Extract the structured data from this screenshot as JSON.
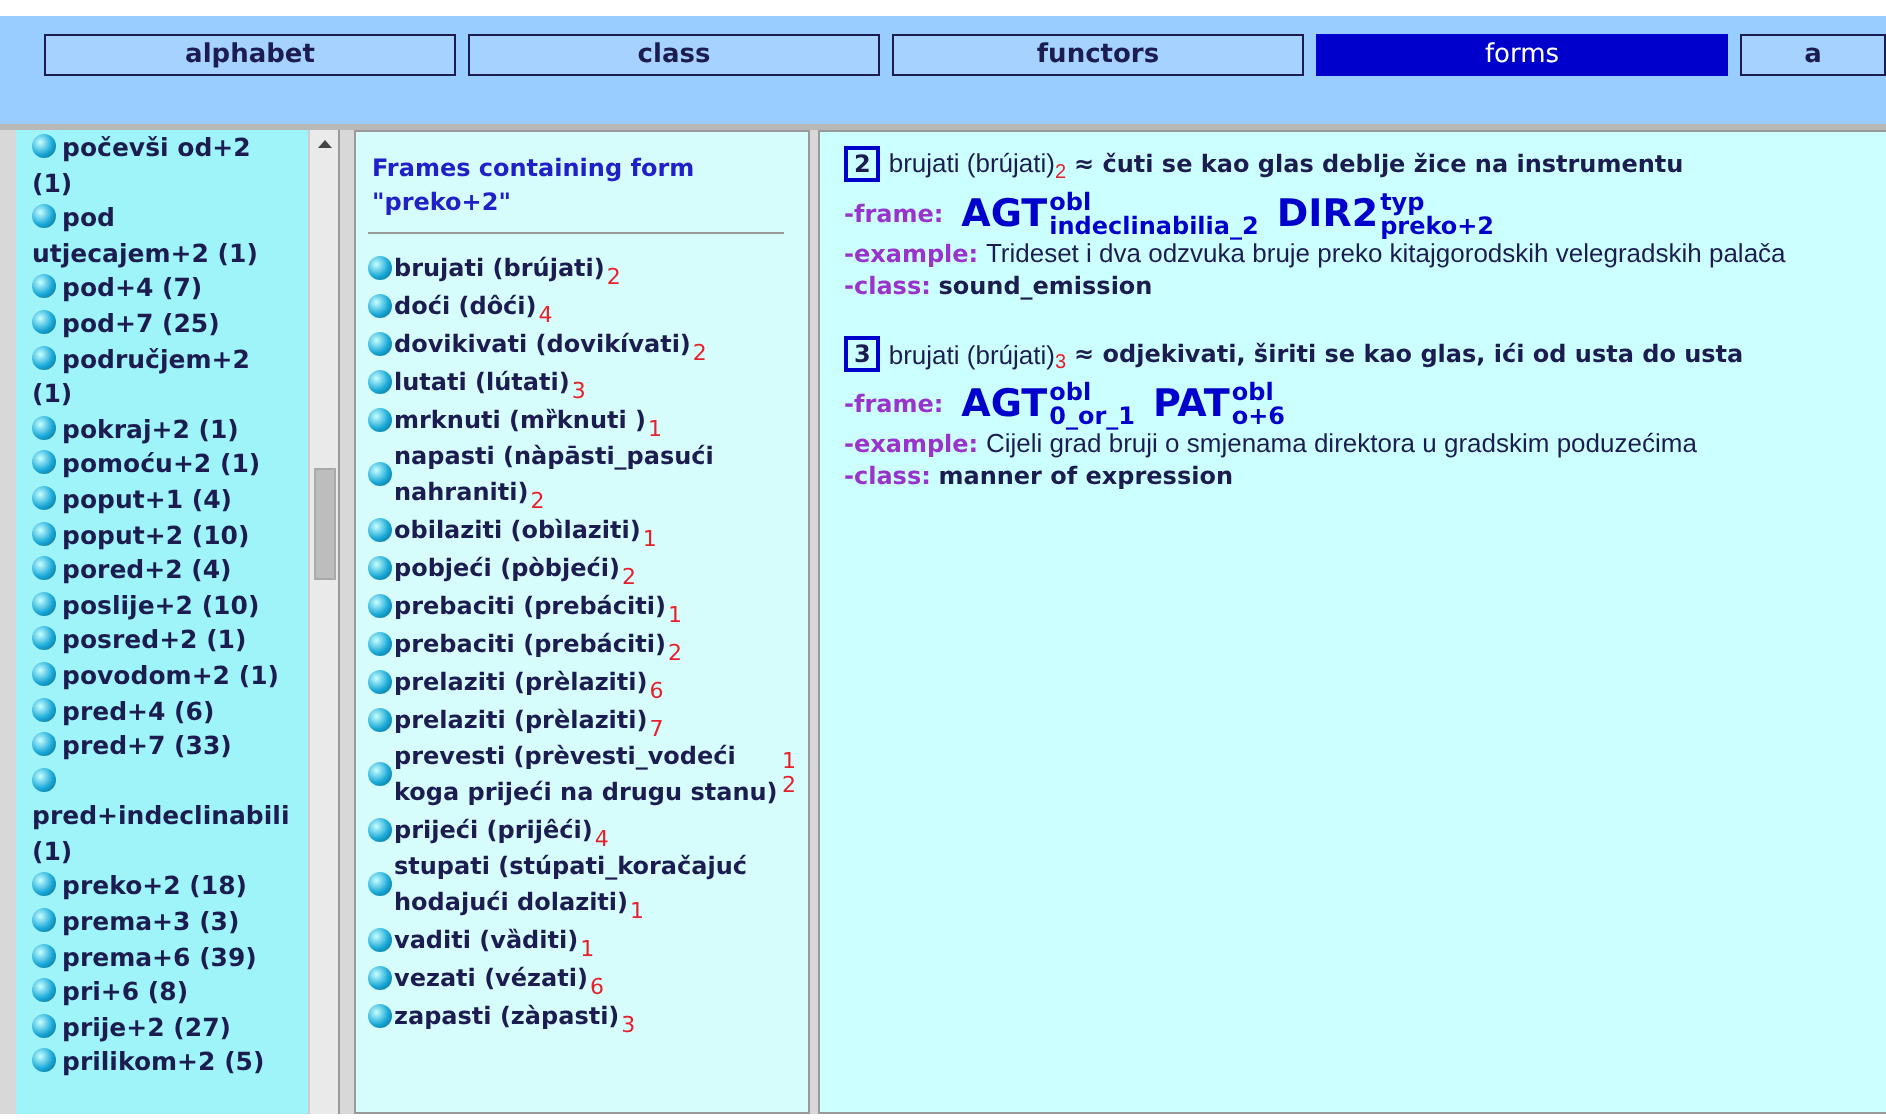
{
  "tabs": [
    {
      "label": "alphabet",
      "selected": false
    },
    {
      "label": "class",
      "selected": false
    },
    {
      "label": "functors",
      "selected": false
    },
    {
      "label": "forms",
      "selected": true
    },
    {
      "label": "a",
      "selected": false
    }
  ],
  "forms_list": {
    "items": [
      {
        "label": "počevši od+2 (1)"
      },
      {
        "label": "pod utjecajem+2 (1)"
      },
      {
        "label": "pod+4 (7)"
      },
      {
        "label": "pod+7 (25)"
      },
      {
        "label": "područjem+2 (1)"
      },
      {
        "label": "pokraj+2 (1)"
      },
      {
        "label": "pomoću+2 (1)"
      },
      {
        "label": "poput+1 (4)"
      },
      {
        "label": "poput+2 (10)"
      },
      {
        "label": "pored+2 (4)"
      },
      {
        "label": "poslije+2 (10)"
      },
      {
        "label": "posred+2 (1)"
      },
      {
        "label": "povodom+2 (1)"
      },
      {
        "label": "pred+4 (6)"
      },
      {
        "label": "pred+7 (33)"
      },
      {
        "label": "pred+indeclinabili (1)"
      },
      {
        "label": "preko+2 (18)"
      },
      {
        "label": "prema+3 (3)"
      },
      {
        "label": "prema+6 (39)"
      },
      {
        "label": "pri+6 (8)"
      },
      {
        "label": "prije+2 (27)"
      },
      {
        "label": "prilikom+2 (5)"
      }
    ]
  },
  "frames_panel": {
    "title": "Frames containing form \"preko+2\"",
    "items": [
      {
        "kind": "inline",
        "label": "brujati (brújati)",
        "senses": [
          "2"
        ]
      },
      {
        "kind": "inline",
        "label": "doći (dôći)",
        "senses": [
          "4"
        ]
      },
      {
        "kind": "inline",
        "label": "dovikivati (dovikívati)",
        "senses": [
          "2"
        ]
      },
      {
        "kind": "inline",
        "label": "lutati (lútati)",
        "senses": [
          "3"
        ]
      },
      {
        "kind": "inline",
        "label": "mrknuti (mȑknuti )",
        "senses": [
          "1"
        ]
      },
      {
        "kind": "inline",
        "label": "napasti (nàpāsti_pasući nahraniti)",
        "senses": [
          "2"
        ]
      },
      {
        "kind": "inline",
        "label": "obilaziti (obìlaziti)",
        "senses": [
          "1"
        ]
      },
      {
        "kind": "inline",
        "label": "pobjeći (pòbjeći)",
        "senses": [
          "2"
        ]
      },
      {
        "kind": "inline",
        "label": "prebaciti (prebáciti)",
        "senses": [
          "1"
        ]
      },
      {
        "kind": "inline",
        "label": "prebaciti (prebáciti)",
        "senses": [
          "2"
        ]
      },
      {
        "kind": "inline",
        "label": "prelaziti (prèlaziti)",
        "senses": [
          "6"
        ]
      },
      {
        "kind": "inline",
        "label": "prelaziti (prèlaziti)",
        "senses": [
          "7"
        ]
      },
      {
        "kind": "split",
        "label": "prevesti (prèvesti_vodeći koga prijeći na drugu stanu)",
        "senses": [
          "1",
          "2"
        ]
      },
      {
        "kind": "inline",
        "label": "prijeći (prijêći)",
        "senses": [
          "4"
        ]
      },
      {
        "kind": "inline",
        "label": "stupati (stúpati_koračajuć hodajući dolaziti)",
        "senses": [
          "1"
        ]
      },
      {
        "kind": "inline",
        "label": "vaditi (vȁditi)",
        "senses": [
          "1"
        ]
      },
      {
        "kind": "inline",
        "label": "vezati (vézati)",
        "senses": [
          "6"
        ]
      },
      {
        "kind": "inline",
        "label": "zapasti (zàpasti)",
        "senses": [
          "3"
        ]
      }
    ]
  },
  "senses": [
    {
      "number": "2",
      "lemma": "brujati (brújati)",
      "sense": "2",
      "approx": "≈",
      "definition": "čuti se kao glas deblje žice na instrumentu",
      "frame_label": "-frame:",
      "frame": [
        {
          "role": "AGT",
          "sup": "obl",
          "sub": "indeclinabilia_2"
        },
        {
          "role": "DIR2",
          "sup": "typ",
          "sub": "preko+2"
        }
      ],
      "example_label": "-example:",
      "example": "Trideset i dva odzvuka bruje preko kitajgorodskih velegradskih palača",
      "class_label": "-class:",
      "class": "sound_emission"
    },
    {
      "number": "3",
      "lemma": "brujati (brújati)",
      "sense": "3",
      "approx": "≈",
      "definition": "odjekivati, širiti se kao glas, ići od usta do usta",
      "frame_label": "-frame:",
      "frame": [
        {
          "role": "AGT",
          "sup": "obl",
          "sub": "0_or_1"
        },
        {
          "role": "PAT",
          "sup": "obl",
          "sub": "o+6"
        }
      ],
      "example_label": "-example:",
      "example": "Cijeli grad bruji o smjenama direktora u gradskim poduzećima",
      "class_label": "-class:",
      "class": "manner of expression"
    }
  ]
}
